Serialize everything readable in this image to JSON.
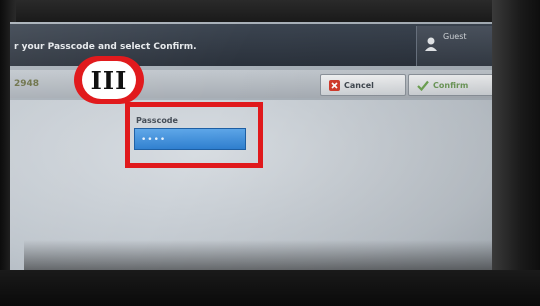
{
  "status_bar": {
    "instruction": "r your Passcode and select Confirm.",
    "user_label": "Guest"
  },
  "toolbar": {
    "job_number": "2948",
    "cancel_label": "Cancel",
    "confirm_label": "Confirm"
  },
  "form": {
    "passcode_label": "Passcode",
    "passcode_value": "••••"
  },
  "annotation": {
    "step_label": "III",
    "color": "#e0191c"
  },
  "colors": {
    "field_blue": "#3a8ad6",
    "topbar": "#2f3640"
  }
}
